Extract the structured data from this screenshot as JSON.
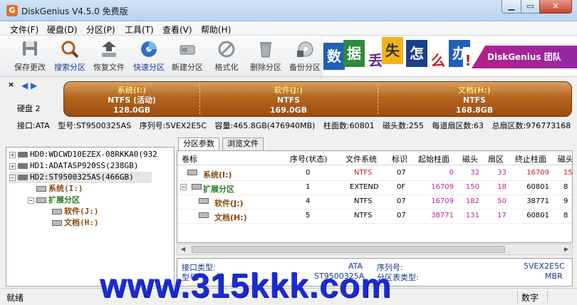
{
  "window": {
    "title": "DiskGenius V4.5.0 免费版",
    "icon_letter": "G"
  },
  "menu": [
    "文件(F)",
    "硬盘(D)",
    "分区(P)",
    "工具(T)",
    "查看(V)",
    "帮助(H)"
  ],
  "toolbar": [
    {
      "label": "保存更改",
      "icon": "save-icon"
    },
    {
      "label": "搜索分区",
      "icon": "magnifier-icon"
    },
    {
      "label": "恢复文件",
      "icon": "restore-icon"
    },
    {
      "label": "快速分区",
      "icon": "quick-partition-icon"
    },
    {
      "label": "新建分区",
      "icon": "new-partition-icon"
    },
    {
      "label": "格式化",
      "icon": "format-icon"
    },
    {
      "label": "删除分区",
      "icon": "trash-icon"
    },
    {
      "label": "备份分区",
      "icon": "backup-disc-icon"
    }
  ],
  "banner": {
    "chars": [
      "数",
      "据",
      "丢",
      "失",
      "怎",
      "么",
      "办",
      "!"
    ],
    "brand": "DiskGenius 团队"
  },
  "disk": {
    "label": "硬盘 2",
    "partitions": [
      {
        "name": "系统(I:)",
        "fs": "NTFS (活动)",
        "size": "128.0GB"
      },
      {
        "name": "软件(J:)",
        "fs": "NTFS",
        "size": "169.0GB"
      },
      {
        "name": "文档(H:)",
        "fs": "NTFS",
        "size": "168.8GB"
      }
    ]
  },
  "info_line": [
    "接口:ATA",
    "型号:ST9500325AS",
    "序列号:5VEX2E5C",
    "容量:465.8GB(476940MB)",
    "柱面数:60801",
    "磁头数:255",
    "每道扇区数:63",
    "总扇区数:976773168"
  ],
  "tree": {
    "disks": [
      "HD0:WDCWD10EZEX-08RKKA0(932",
      "HD1:ADATASP920SS(238GB)",
      "HD2:ST9500325AS(466GB)"
    ],
    "partitions": [
      {
        "label": "系统(I:)"
      },
      {
        "label": "扩展分区"
      },
      {
        "label": "软件(J:)"
      },
      {
        "label": "文档(H:)"
      }
    ]
  },
  "tabs": [
    "分区参数",
    "浏览文件"
  ],
  "table": {
    "headers": [
      "卷标",
      "序号(状态)",
      "文件系统",
      "标识",
      "起始柱面",
      "磁头",
      "扇区",
      "终止柱面",
      "磁头"
    ],
    "rows": [
      {
        "label": "系统(I:)",
        "idx": "0",
        "fs": "NTFS",
        "id": "07",
        "start_cyl": "0",
        "head": "32",
        "sector": "33",
        "end_cyl": "16709",
        "end_head": "15"
      },
      {
        "label": "扩展分区",
        "idx": "1",
        "fs": "EXTEND",
        "id": "0F",
        "start_cyl": "16709",
        "head": "150",
        "sector": "18",
        "end_cyl": "60801",
        "end_head": "8"
      },
      {
        "label": "软件(J:)",
        "idx": "4",
        "fs": "NTFS",
        "id": "07",
        "start_cyl": "16709",
        "head": "182",
        "sector": "50",
        "end_cyl": "38771",
        "end_head": "9"
      },
      {
        "label": "文档(H:)",
        "idx": "5",
        "fs": "NTFS",
        "id": "07",
        "start_cyl": "38771",
        "head": "131",
        "sector": "17",
        "end_cyl": "60801",
        "end_head": "8"
      }
    ]
  },
  "bottom_info": {
    "iface_label": "接口类型:",
    "iface_value": "ATA",
    "serial_label": "序列号:",
    "serial_value": "5VEX2E5C",
    "model_label": "型号:",
    "model_value": "ST9500325A",
    "pt_label": "分区表类型:",
    "pt_value": "MBR"
  },
  "status": {
    "text": "就绪",
    "numlock": "数字"
  },
  "watermark": "www.315kkk.com",
  "colors": {
    "disk_bar": "#b5651e",
    "partition_name": "#ffe977",
    "magenta_value": "#b41fa6",
    "ntfs_red": "#d11a1a",
    "watermark": "#1a2bd6"
  }
}
